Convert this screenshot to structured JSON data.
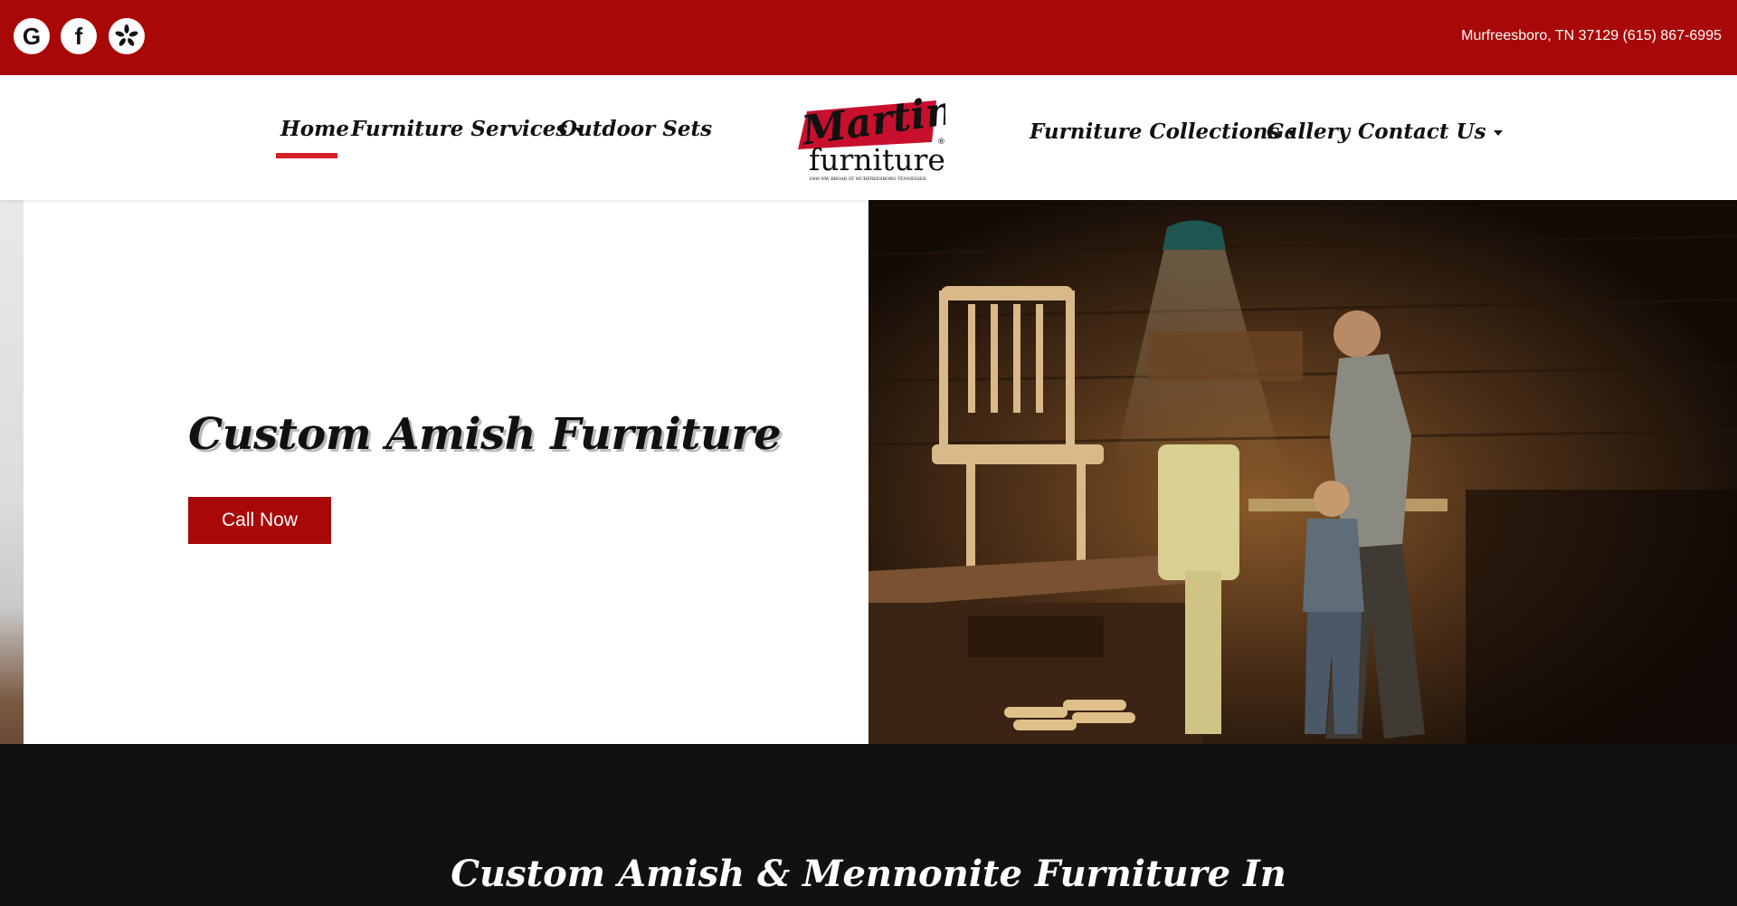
{
  "social": {
    "icons": [
      "google-icon",
      "facebook-icon",
      "yelp-icon"
    ],
    "google_glyph": "G",
    "facebook_glyph": "f"
  },
  "topbar": {
    "contact": "Murfreesboro, TN 37129 (615) 867-6995"
  },
  "nav": {
    "left": [
      {
        "label": "Home",
        "active": true
      },
      {
        "label": "Furniture Services",
        "dropdown": true
      },
      {
        "label": "Outdoor Sets"
      }
    ],
    "right": [
      {
        "label": "Furniture Collections",
        "dropdown": true
      },
      {
        "label": "Gallery"
      },
      {
        "label": "Contact Us",
        "dropdown": true
      }
    ]
  },
  "logo": {
    "brand": "Martin",
    "sub": "furniture",
    "tagline": "1000 NW BROAD ST MURFREESBORO TENNESSEE",
    "mark": "®"
  },
  "hero": {
    "title": "Custom Amish Furniture",
    "cta": "Call Now"
  },
  "section": {
    "title": "Custom Amish & Mennonite Furniture In"
  },
  "colors": {
    "brand_red": "#a90808",
    "accent_red": "#d42027",
    "dark_bg": "#111111"
  }
}
